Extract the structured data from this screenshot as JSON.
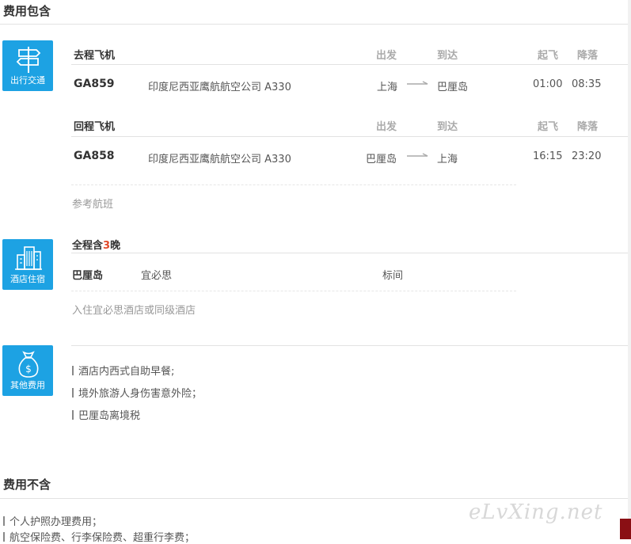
{
  "included": {
    "title": "费用包含",
    "transport": {
      "badge_label": "出行交通",
      "outbound": {
        "header": "去程飞机",
        "col_depart": "出发",
        "col_arrive": "到达",
        "col_takeoff": "起飞",
        "col_land": "降落",
        "flight_no": "GA859",
        "airline": "印度尼西亚鹰航航空公司 A330",
        "from": "上海",
        "to": "巴厘岛",
        "takeoff": "01:00",
        "land": "08:35"
      },
      "return": {
        "header": "回程飞机",
        "col_depart": "出发",
        "col_arrive": "到达",
        "col_takeoff": "起飞",
        "col_land": "降落",
        "flight_no": "GA858",
        "airline": "印度尼西亚鹰航航空公司 A330",
        "from": "巴厘岛",
        "to": "上海",
        "takeoff": "16:15",
        "land": "23:20"
      },
      "note": "参考航班"
    },
    "hotel": {
      "badge_label": "酒店住宿",
      "header_prefix": "全程含",
      "nights": "3",
      "header_suffix": "晚",
      "city": "巴厘岛",
      "hotel_name": "宜必思",
      "room_type": "标间",
      "note": "入住宜必思酒店或同级酒店"
    },
    "other": {
      "badge_label": "其他费用",
      "items": [
        "酒店内西式自助早餐;",
        "境外旅游人身伤害意外险；",
        "巴厘岛离境税"
      ]
    }
  },
  "excluded": {
    "title": "费用不含",
    "items": [
      "个人护照办理费用；",
      "航空保险费、行李保险费、超重行李费；"
    ]
  },
  "watermark": "eLvXing.net",
  "colors": {
    "accent": "#1da2e3",
    "highlight": "#e04a2a"
  }
}
